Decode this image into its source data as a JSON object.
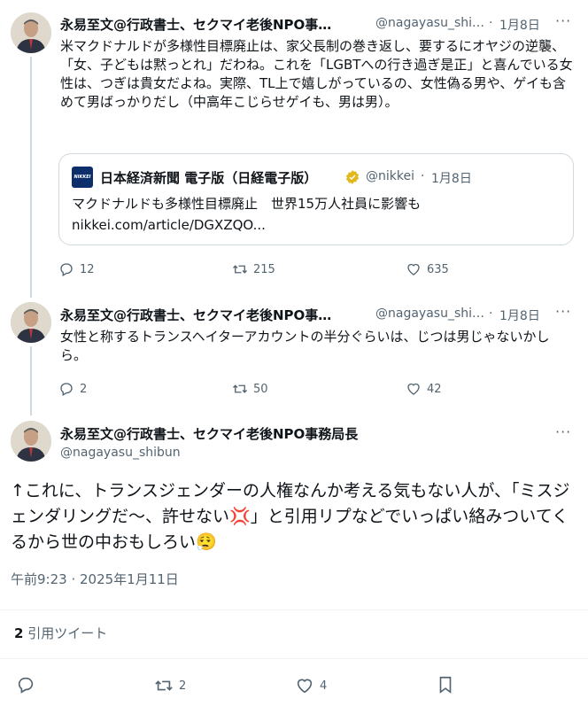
{
  "tweets": [
    {
      "author_name": "永易至文@行政書士、セクマイ老後NPO事…",
      "handle": "@nagayasu_shi…",
      "date": "1月8日",
      "text": "米マクドナルドが多様性目標廃止は、家父長制の巻き返し、要するにオヤジの逆襲、「女、子どもは黙っとれ」だわね。これを「LGBTへの行き過ぎ是正」と喜んでいる女性は、つぎは貴女だよね。実際、TL上で嬉しがっているの、女性偽る男や、ゲイも含めて男ばっかりだし（中高年こじらせゲイも、男は男）。",
      "quote": {
        "logo_text": "NIKKEI",
        "source_name": "日本経済新聞 電子版（日経電子版）",
        "handle": "@nikkei",
        "date": "1月8日",
        "text": "マクドナルドも多様性目標廃止　世界15万人社員に影響も",
        "link": "nikkei.com/article/DGXZQO..."
      },
      "replies": "12",
      "retweets": "215",
      "likes": "635"
    },
    {
      "author_name": "永易至文@行政書士、セクマイ老後NPO事…",
      "handle": "@nagayasu_shi…",
      "date": "1月8日",
      "text": "女性と称するトランスヘイターアカウントの半分ぐらいは、じつは男じゃないかしら。",
      "replies": "2",
      "retweets": "50",
      "likes": "42"
    }
  ],
  "main_tweet": {
    "author_name": "永易至文@行政書士、セクマイ老後NPO事務局長",
    "handle": "@nagayasu_shibun",
    "text_part1": "↑これに、トランスジェンダーの人権なんか考える気もない人が、「ミスジェンダリングだ〜、許せない",
    "emoji_anger": "💢",
    "text_part2": "」と引用リプなどでいっぱい絡みついてくるから世の中おもしろい",
    "emoji_face": "😮‍💨",
    "timestamp": "午前9:23 · 2025年1月11日",
    "quote_count": "2",
    "quote_label": "引用ツイート",
    "retweets": "2",
    "likes": "4"
  },
  "more_label": "···",
  "colors": {
    "text": "#0f1419",
    "secondary": "#536471",
    "border": "#cfd9de",
    "verified_gold": "#e2b719",
    "nikkei_blue": "#0c2f6b"
  },
  "icons": [
    "reply-icon",
    "retweet-icon",
    "like-icon",
    "bookmark-icon",
    "more-icon",
    "verified-badge-icon"
  ]
}
